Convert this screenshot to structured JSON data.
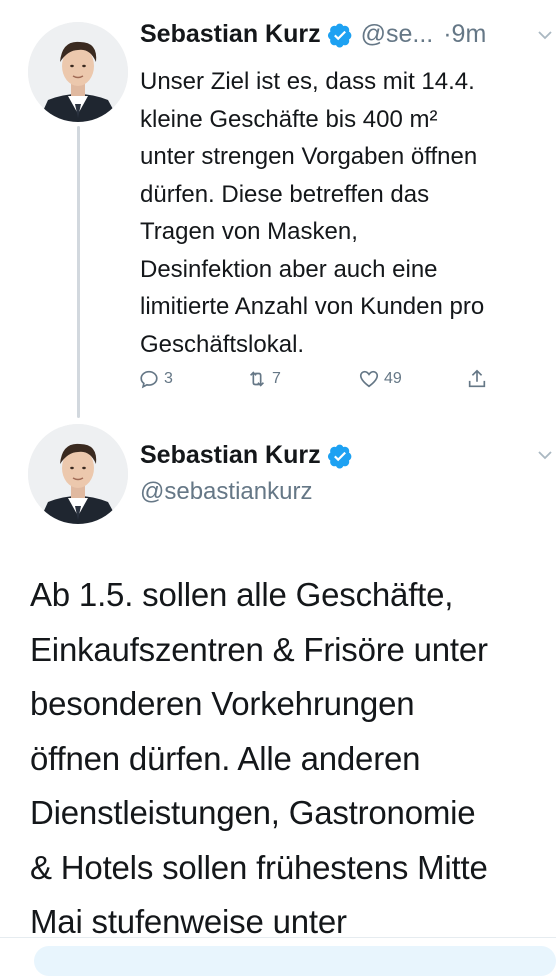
{
  "tweet1": {
    "name": "Sebastian Kurz",
    "handle": "@se...",
    "time": "·9m",
    "text": "Unser Ziel ist es, dass mit 14.4. kleine Geschäfte bis 400 m² unter strengen Vorgaben öffnen dürfen. Diese betreffen das Tragen von Masken, Desinfektion aber auch eine limitierte Anzahl von Kunden pro Geschäftslokal.",
    "text_lines": [
      "Unser Ziel ist es, dass mit 14.4.",
      "kleine Geschäfte bis 400 m²",
      "unter strengen Vorgaben öffnen",
      "dürfen. Diese betreffen das",
      "Tragen von Masken,",
      "Desinfektion aber auch eine",
      "limitierte Anzahl von Kunden pro",
      "Geschäftslokal."
    ],
    "replies": "3",
    "retweets": "7",
    "likes": "49"
  },
  "tweet2": {
    "name": "Sebastian Kurz",
    "handle": "@sebastiankurz",
    "text_lines": [
      "Ab 1.5. sollen alle Geschäfte,",
      "Einkaufszentren & Frisöre unter",
      "besonderen Vorkehrungen",
      "öffnen dürfen. Alle anderen",
      "Dienstleistungen, Gastronomie",
      "& Hotels sollen frühestens Mitte",
      "Mai stufenweise unter"
    ]
  },
  "icons": {
    "verified": "verified-badge-icon",
    "reply": "reply-icon",
    "retweet": "retweet-icon",
    "like": "heart-icon",
    "share": "share-icon",
    "caret": "chevron-down-icon"
  },
  "colors": {
    "verified_blue": "#1da1f2",
    "secondary_text": "#657786",
    "primary_text": "#14171a",
    "thread_line": "#d2d8de"
  }
}
